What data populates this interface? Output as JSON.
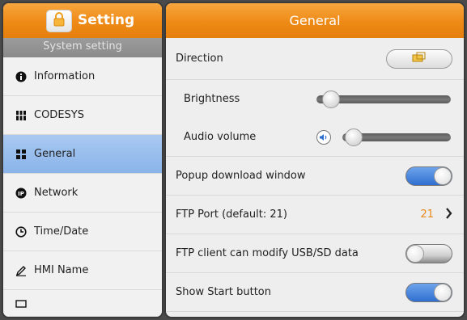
{
  "app": {
    "title": "Setting"
  },
  "sidebar": {
    "section": "System setting",
    "items": [
      {
        "label": "Information"
      },
      {
        "label": "CODESYS"
      },
      {
        "label": "General"
      },
      {
        "label": "Network"
      },
      {
        "label": "Time/Date"
      },
      {
        "label": "HMI Name"
      }
    ]
  },
  "main": {
    "title": "General",
    "direction_label": "Direction",
    "brightness_label": "Brightness",
    "brightness_level": 0.05,
    "audio_label": "Audio volume",
    "audio_level": 0.05,
    "popup_label": "Popup download window",
    "popup_on": true,
    "ftp_port_label": "FTP Port  (default: 21)",
    "ftp_port_value": "21",
    "ftp_modify_label": "FTP client can modify USB/SD data",
    "ftp_modify_on": false,
    "start_button_label": "Show Start button",
    "start_button_on": true
  },
  "colors": {
    "accent": "#ee8a16",
    "active_nav": "#9cc0ee",
    "toggle_on": "#2f6fd0",
    "port_value": "#e8891a"
  }
}
